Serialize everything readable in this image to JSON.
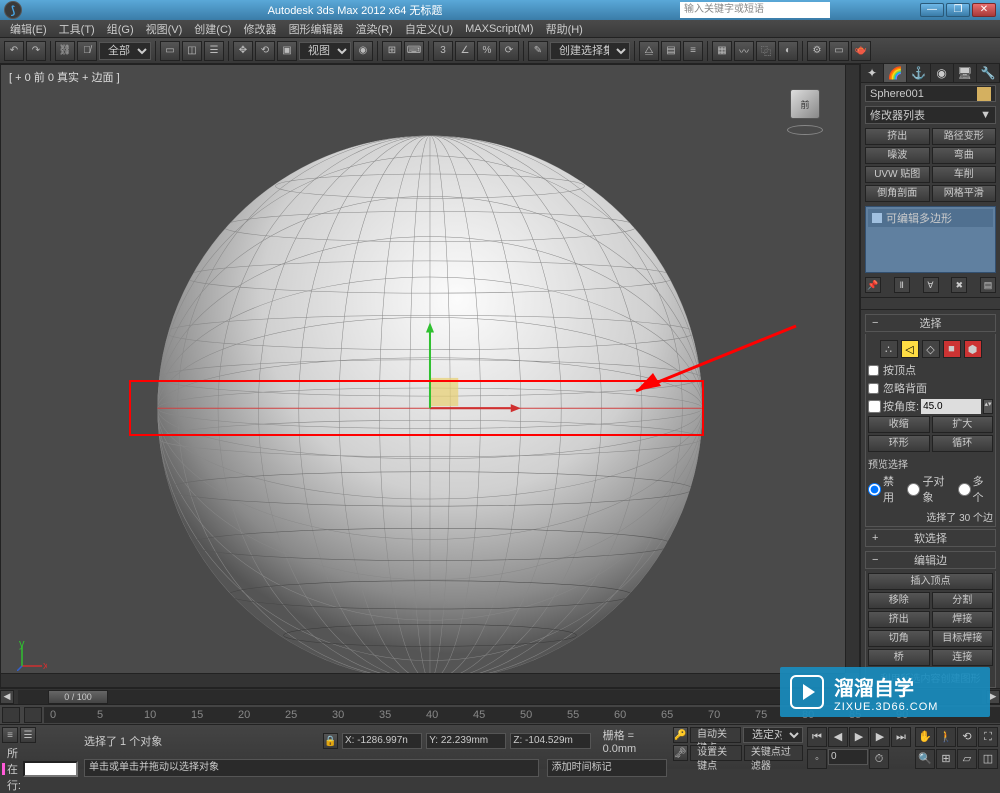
{
  "title": "Autodesk 3ds Max 2012 x64   无标题",
  "search_placeholder": "输入关键字或短语",
  "menu": [
    "编辑(E)",
    "工具(T)",
    "组(G)",
    "视图(V)",
    "创建(C)",
    "修改器",
    "图形编辑器",
    "渲染(R)",
    "自定义(U)",
    "MAXScript(M)",
    "帮助(H)"
  ],
  "toolbar_scope": "全部",
  "toolbar_view": "视图",
  "toolbar_selset": "创建选择集",
  "view_label": "[ + 0 前 0 真实 + 边面 ]",
  "viewcube_face": "前",
  "object_name": "Sphere001",
  "modifier_dropdown": "修改器列表",
  "mod_buttons": [
    [
      "挤出",
      "路径变形"
    ],
    [
      "噪波",
      "弯曲"
    ],
    [
      "UVW 贴图",
      "车削"
    ],
    [
      "倒角剖面",
      "网格平滑"
    ]
  ],
  "stack_item": "可编辑多边形",
  "rollout_select": "选择",
  "chk_byvertex": "按顶点",
  "chk_ignoreback": "忽略背面",
  "chk_byangle": "按角度:",
  "angle_value": "45.0",
  "btn_shrink": "收缩",
  "btn_grow": "扩大",
  "btn_ring": "环形",
  "btn_loop": "循环",
  "preview_sel": "预览选择",
  "radio_off": "禁用",
  "radio_sub": "子对象",
  "radio_multi": "多个",
  "sel_count": "选择了 30 个边",
  "rollout_soft": "软选择",
  "rollout_editedge": "编辑边",
  "btn_insertv": "插入顶点",
  "btn_remove": "移除",
  "btn_split": "分割",
  "btn_extrude": "挤出",
  "btn_weld": "焊接",
  "btn_chamfer": "切角",
  "btn_targetweld": "目标焊接",
  "btn_bridge": "桥",
  "btn_connect": "连接",
  "txt_createshape": "利用所选内容创建图形",
  "timeline_thumb": "0 / 100",
  "status_obj": "选择了 1 个对象",
  "coord_x": "X: -1286.997n",
  "coord_y": "Y: 22.239mm",
  "coord_z": "Z: -104.529m",
  "grid": "栅格 = 0.0mm",
  "hint": "单击或单击并拖动以选择对象",
  "addtime": "添加时间标记",
  "autokey": "自动关键点",
  "setkey": "设置关键点",
  "selset_label": "选定对象",
  "keyfilter": "关键点过滤器",
  "tag_label": "所在行:",
  "wm_big": "溜溜自学",
  "wm_small": "ZIXUE.3D66.COM",
  "ruler_ticks": [
    "0",
    "5",
    "10",
    "15",
    "20",
    "25",
    "30",
    "35",
    "40",
    "45",
    "50",
    "55",
    "60",
    "65",
    "70",
    "75",
    "80",
    "85",
    "90"
  ]
}
